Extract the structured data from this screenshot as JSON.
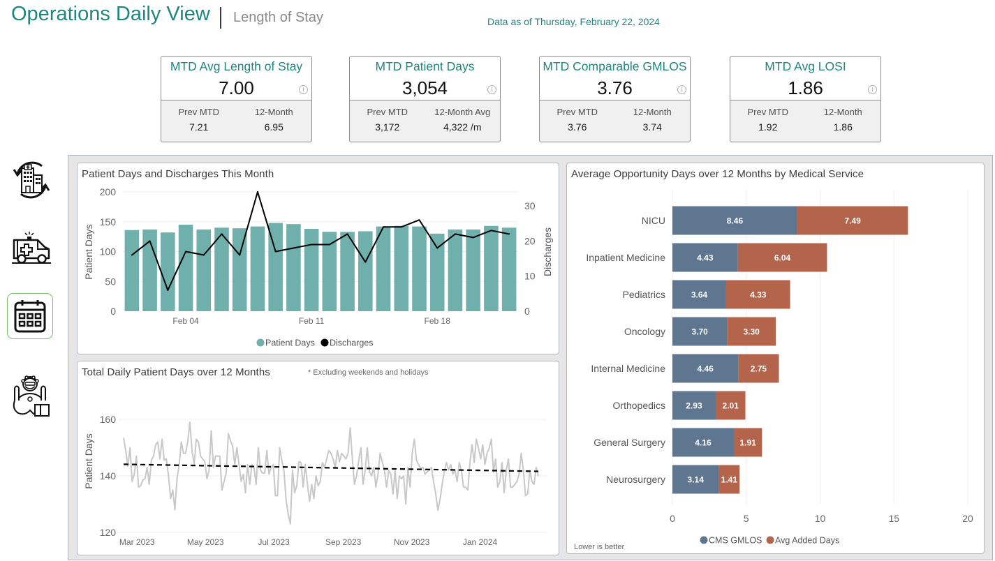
{
  "header": {
    "title": "Operations Daily View",
    "subtitle": "Length of Stay",
    "data_as_of": "Data as of Thursday, February 22, 2024"
  },
  "kpis": [
    {
      "title": "MTD Avg Length of Stay",
      "value": "7.00",
      "info": "i",
      "left_label": "Prev MTD",
      "left_value": "7.21",
      "right_label": "12-Month",
      "right_value": "6.95"
    },
    {
      "title": "MTD Patient Days",
      "value": "3,054",
      "info": "i",
      "left_label": "Prev MTD",
      "left_value": "3,172",
      "right_label": "12-Month Avg",
      "right_value": "4,322 /m"
    },
    {
      "title": "MTD Comparable GMLOS",
      "value": "3.76",
      "info": "i",
      "left_label": "Prev MTD",
      "left_value": "3.76",
      "right_label": "12-Month",
      "right_value": "3.74"
    },
    {
      "title": "MTD Avg LOSI",
      "value": "1.86",
      "info": "i",
      "left_label": "Prev MTD",
      "left_value": "1.92",
      "right_label": "12-Month",
      "right_value": "1.86"
    }
  ],
  "nav": [
    {
      "icon": "hospital-transfer-icon",
      "active": false
    },
    {
      "icon": "ambulance-icon",
      "active": false
    },
    {
      "icon": "calendar-icon",
      "active": true
    },
    {
      "icon": "doctor-icon",
      "active": false
    }
  ],
  "colors": {
    "brand_teal": "#1e8582",
    "patient_days_bar": "#70b0ac",
    "discharges_line": "#000000",
    "daily_line": "#c8c8c8",
    "trend_line": "#000000",
    "cms_gmlos": "#5f7690",
    "avg_added_days": "#b4644a",
    "active_nav_border": "#7cc06a"
  },
  "chart_data": [
    {
      "type": "bar",
      "title": "Patient Days and Discharges This Month",
      "categories": [
        "Feb 01",
        "Feb 02",
        "Feb 03",
        "Feb 04",
        "Feb 05",
        "Feb 06",
        "Feb 07",
        "Feb 08",
        "Feb 09",
        "Feb 10",
        "Feb 11",
        "Feb 12",
        "Feb 13",
        "Feb 14",
        "Feb 15",
        "Feb 16",
        "Feb 17",
        "Feb 18",
        "Feb 19",
        "Feb 20",
        "Feb 21",
        "Feb 22"
      ],
      "x_ticks": [
        "Feb 04",
        "Feb 11",
        "Feb 18"
      ],
      "series": [
        {
          "name": "Patient Days",
          "type": "bar",
          "axis": "left",
          "values": [
            136,
            137,
            132,
            145,
            137,
            140,
            139,
            142,
            148,
            146,
            138,
            133,
            133,
            134,
            142,
            143,
            142,
            130,
            137,
            137,
            143,
            140
          ]
        },
        {
          "name": "Discharges",
          "type": "line",
          "axis": "right",
          "values": [
            16,
            20,
            6,
            17,
            16,
            22,
            16,
            34,
            17,
            18,
            19,
            19,
            22,
            14,
            24,
            24,
            26,
            18,
            22,
            21,
            23,
            22
          ]
        }
      ],
      "y_left": {
        "label": "Patient Days",
        "range": [
          0,
          200
        ],
        "ticks": [
          0,
          50,
          100,
          150,
          200
        ]
      },
      "y_right": {
        "label": "Discharges",
        "range": [
          0,
          34
        ],
        "ticks": [
          0,
          10,
          20,
          30
        ]
      },
      "grid": true,
      "legend": {
        "position": "bottom",
        "entries": [
          "Patient Days",
          "Discharges"
        ]
      }
    },
    {
      "type": "line",
      "title": "Total Daily Patient Days over 12 Months",
      "note": "* Excluding weekends and holidays",
      "ylabel": "Patient Days",
      "ylim": [
        120,
        167
      ],
      "y_ticks": [
        120,
        140,
        160
      ],
      "x_range": [
        "2023-02-17",
        "2024-02-22"
      ],
      "x_ticks": [
        {
          "label": "Mar 2023",
          "date": "2023-03-01"
        },
        {
          "label": "May 2023",
          "date": "2023-05-01"
        },
        {
          "label": "Jul 2023",
          "date": "2023-07-01"
        },
        {
          "label": "Sep 2023",
          "date": "2023-09-01"
        },
        {
          "label": "Nov 2023",
          "date": "2023-11-01"
        },
        {
          "label": "Jan 2024",
          "date": "2024-01-01"
        }
      ],
      "grid": true,
      "series": [
        {
          "name": "Total Daily Patient Days",
          "values": [
            153.4,
            149,
            143.5,
            150,
            138,
            140.6,
            147,
            136,
            136.5,
            138.5,
            139,
            143,
            137,
            145.5,
            147,
            151,
            152,
            146,
            153,
            145.5,
            146,
            140,
            132,
            135,
            128,
            139,
            144,
            152,
            148,
            148,
            152,
            159,
            149,
            144,
            153,
            152,
            147,
            146,
            145,
            139,
            142,
            156,
            143,
            147,
            147,
            147,
            135,
            138,
            141,
            155,
            152.5,
            150.5,
            144,
            150,
            144,
            138,
            140.5,
            134,
            144,
            137,
            144,
            143,
            137,
            150,
            142,
            141,
            141,
            149,
            140.6,
            143,
            144,
            133,
            133,
            150,
            145.5,
            142,
            131.5,
            126.5,
            123,
            142,
            134,
            136.5,
            145,
            144.7,
            136,
            144,
            137,
            131,
            137,
            132,
            140,
            136.5,
            138,
            144.7,
            143,
            146,
            149,
            148,
            146,
            143,
            149,
            145,
            148,
            147,
            146,
            148,
            157,
            146,
            137,
            140,
            145.5,
            150,
            137,
            142,
            150,
            141.4,
            140,
            143,
            136,
            140.6,
            148,
            145,
            142,
            136,
            142,
            140.6,
            133.6,
            142,
            132,
            140,
            139,
            140,
            130,
            143,
            136,
            148,
            153,
            145.5,
            144,
            142.6,
            143,
            140.6,
            141.4,
            142,
            143,
            138,
            133.6,
            127.8,
            131.5,
            137,
            141.4,
            144.7,
            142,
            144,
            140.6,
            142,
            138,
            144.7,
            142,
            136,
            136,
            135,
            144.7,
            151,
            144.7,
            153,
            149.7,
            146,
            151,
            144,
            148,
            149.7,
            153,
            141.4,
            146,
            136,
            138,
            144.7,
            134,
            142,
            146,
            136,
            136,
            137,
            138,
            140.6,
            148,
            142,
            133,
            133.6,
            142,
            138,
            137,
            143,
            140
          ]
        },
        {
          "name": "Trend",
          "type": "trendline",
          "start": 144.1,
          "end": 141.6
        }
      ]
    },
    {
      "type": "bar",
      "orientation": "horizontal",
      "stacked": true,
      "title": "Average Opportunity Days over 12 Months by Medical Service",
      "categories": [
        "NICU",
        "Inpatient Medicine",
        "Pediatrics",
        "Oncology",
        "Internal Medicine",
        "Orthopedics",
        "General Surgery",
        "Neurosurgery"
      ],
      "series": [
        {
          "name": "CMS GMLOS",
          "values": [
            8.46,
            4.43,
            3.64,
            3.7,
            4.46,
            2.93,
            4.16,
            3.14
          ],
          "labels": [
            "8.46",
            "4.43",
            "3.64",
            "3.70",
            "4.46",
            "2.93",
            "4.16",
            "3.14"
          ]
        },
        {
          "name": "Avg Added Days",
          "values": [
            7.49,
            6.04,
            4.33,
            3.3,
            2.75,
            2.01,
            1.91,
            1.41
          ],
          "labels": [
            "7.49",
            "6.04",
            "4.33",
            "3.30",
            "2.75",
            "2.01",
            "1.91",
            "1.41"
          ]
        }
      ],
      "xlim": [
        0,
        20
      ],
      "x_ticks": [
        0,
        5,
        10,
        15,
        20
      ],
      "grid": true,
      "legend": {
        "position": "bottom",
        "entries": [
          "CMS GMLOS",
          "Avg Added Days"
        ]
      },
      "footnote": "Lower is better"
    }
  ]
}
